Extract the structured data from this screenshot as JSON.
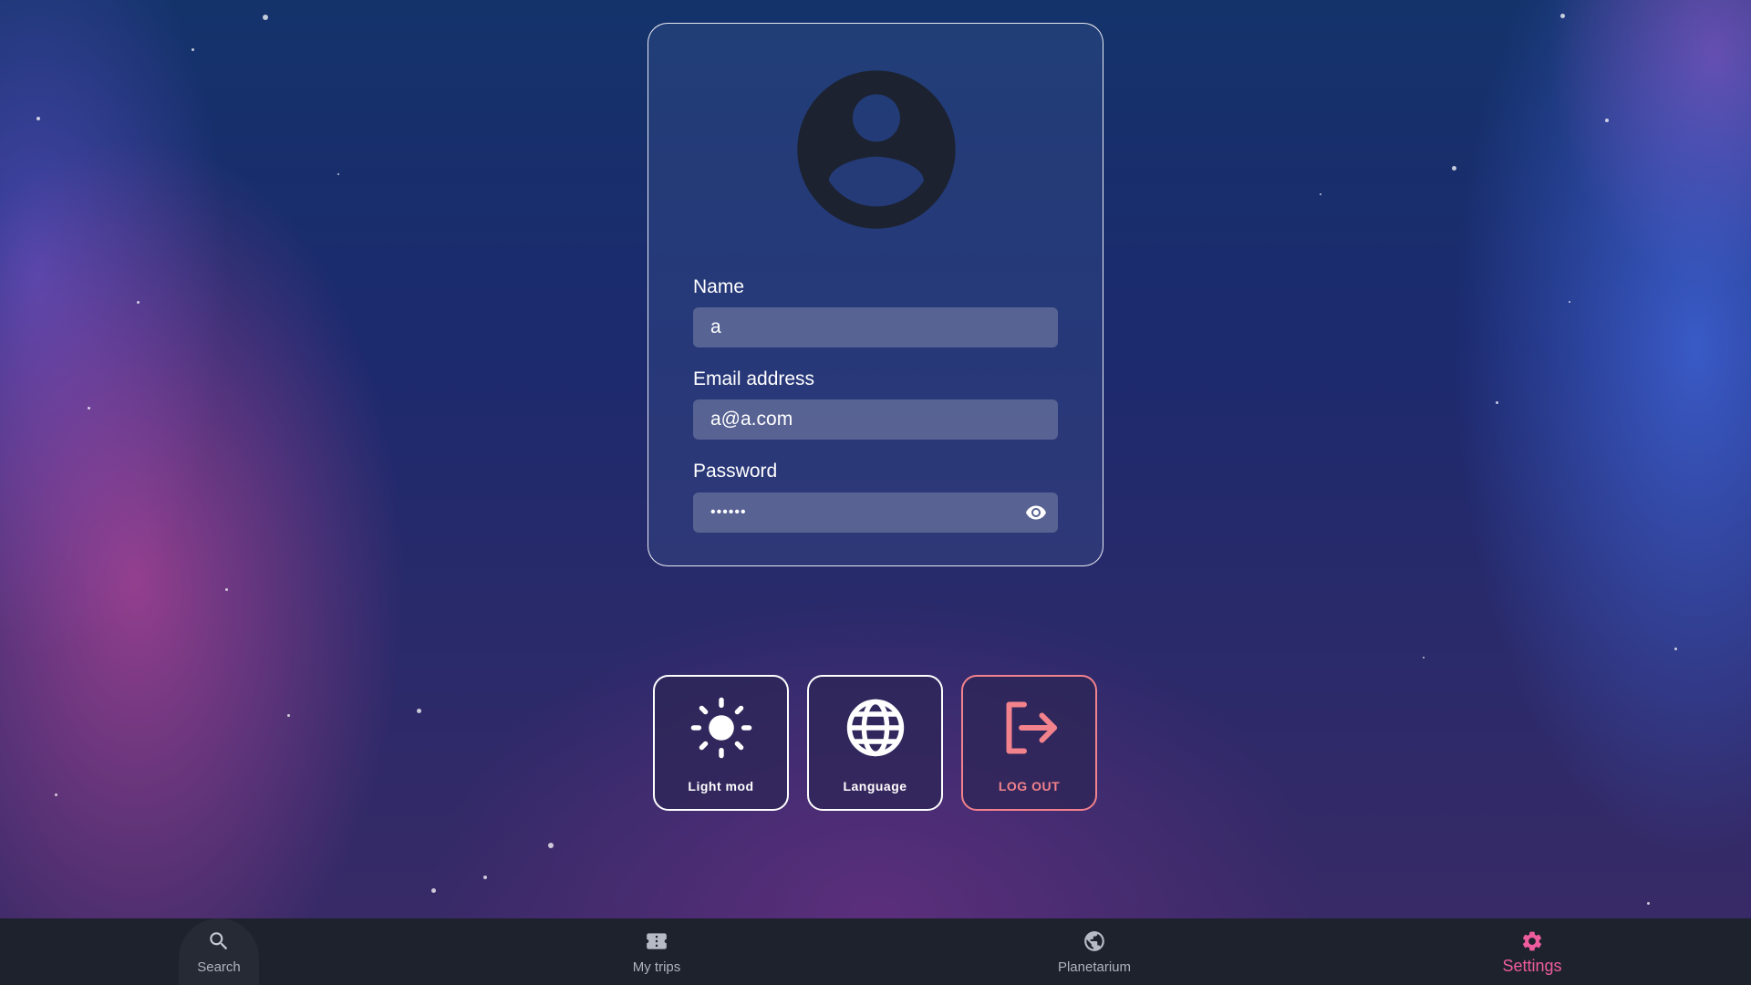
{
  "profile": {
    "avatar_icon": "account-circle-icon",
    "name_label": "Name",
    "name_value": "a",
    "email_label": "Email address",
    "email_value": "a@a.com",
    "password_label": "Password",
    "password_value": "••••••",
    "password_toggle_icon": "eye-icon"
  },
  "actions": {
    "light_mode": {
      "label": "Light mod",
      "icon": "sun-icon"
    },
    "language": {
      "label": "Language",
      "icon": "globe-icon"
    },
    "logout": {
      "label": "LOG OUT",
      "icon": "logout-icon",
      "color": "#f2828c"
    }
  },
  "nav": {
    "items": [
      {
        "label": "Search",
        "icon": "search-icon",
        "active": false
      },
      {
        "label": "My trips",
        "icon": "ticket-icon",
        "active": false
      },
      {
        "label": "Planetarium",
        "icon": "globe-icon",
        "active": false
      },
      {
        "label": "Settings",
        "icon": "gear-icon",
        "active": true
      }
    ],
    "active_color": "#ee5c9e",
    "inactive_color": "#aeb3bf"
  }
}
